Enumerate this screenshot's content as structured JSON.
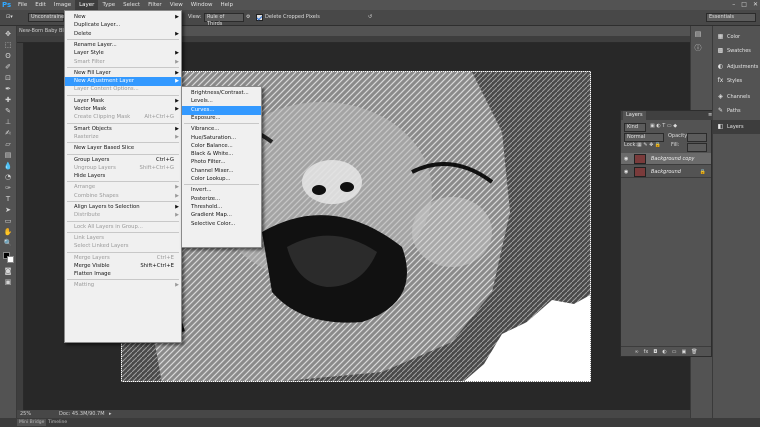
{
  "app": {
    "logo": "Ps",
    "menubar": [
      "File",
      "Edit",
      "Image",
      "Layer",
      "Type",
      "Select",
      "Filter",
      "View",
      "Window",
      "Help"
    ],
    "active_menu": "Layer",
    "window_controls": [
      "–",
      "□",
      "✕"
    ]
  },
  "options_bar": {
    "ratio_select": "Unconstrained",
    "view_label": "View:",
    "view_select": "Rule of Thirds",
    "delete_cropped_label": "Delete Cropped Pixels",
    "workspace_select": "Essentials"
  },
  "document": {
    "tab_title": "New-Born Baby Bla...",
    "zoom": "25%",
    "doc_size": "Doc: 45.3M/90.7M"
  },
  "bottom_tabs": [
    "Mini Bridge",
    "Timeline"
  ],
  "layer_menu": [
    {
      "label": "New",
      "arrow": true
    },
    {
      "label": "Duplicate Layer..."
    },
    {
      "label": "Delete",
      "arrow": true
    },
    {
      "sep": true
    },
    {
      "label": "Rename Layer..."
    },
    {
      "label": "Layer Style",
      "arrow": true
    },
    {
      "label": "Smart Filter",
      "arrow": true,
      "disabled": true
    },
    {
      "sep": true
    },
    {
      "label": "New Fill Layer",
      "arrow": true
    },
    {
      "label": "New Adjustment Layer",
      "arrow": true,
      "highlight": true
    },
    {
      "label": "Layer Content Options...",
      "disabled": true
    },
    {
      "sep": true
    },
    {
      "label": "Layer Mask",
      "arrow": true
    },
    {
      "label": "Vector Mask",
      "arrow": true
    },
    {
      "label": "Create Clipping Mask",
      "shortcut": "Alt+Ctrl+G",
      "disabled": true
    },
    {
      "sep": true
    },
    {
      "label": "Smart Objects",
      "arrow": true
    },
    {
      "label": "Rasterize",
      "arrow": true,
      "disabled": true
    },
    {
      "sep": true
    },
    {
      "label": "New Layer Based Slice"
    },
    {
      "sep": true
    },
    {
      "label": "Group Layers",
      "shortcut": "Ctrl+G"
    },
    {
      "label": "Ungroup Layers",
      "shortcut": "Shift+Ctrl+G",
      "disabled": true
    },
    {
      "label": "Hide Layers"
    },
    {
      "sep": true
    },
    {
      "label": "Arrange",
      "arrow": true,
      "disabled": true
    },
    {
      "label": "Combine Shapes",
      "arrow": true,
      "disabled": true
    },
    {
      "sep": true
    },
    {
      "label": "Align Layers to Selection",
      "arrow": true
    },
    {
      "label": "Distribute",
      "arrow": true,
      "disabled": true
    },
    {
      "sep": true
    },
    {
      "label": "Lock All Layers in Group...",
      "disabled": true
    },
    {
      "sep": true
    },
    {
      "label": "Link Layers",
      "disabled": true
    },
    {
      "label": "Select Linked Layers",
      "disabled": true
    },
    {
      "sep": true
    },
    {
      "label": "Merge Layers",
      "shortcut": "Ctrl+E",
      "disabled": true
    },
    {
      "label": "Merge Visible",
      "shortcut": "Shift+Ctrl+E"
    },
    {
      "label": "Flatten Image"
    },
    {
      "sep": true
    },
    {
      "label": "Matting",
      "arrow": true,
      "disabled": true
    }
  ],
  "adjustment_submenu": [
    {
      "label": "Brightness/Contrast..."
    },
    {
      "label": "Levels..."
    },
    {
      "label": "Curves...",
      "highlight": true
    },
    {
      "label": "Exposure..."
    },
    {
      "sep": true
    },
    {
      "label": "Vibrance..."
    },
    {
      "label": "Hue/Saturation..."
    },
    {
      "label": "Color Balance..."
    },
    {
      "label": "Black & White..."
    },
    {
      "label": "Photo Filter..."
    },
    {
      "label": "Channel Mixer..."
    },
    {
      "label": "Color Lookup..."
    },
    {
      "sep": true
    },
    {
      "label": "Invert..."
    },
    {
      "label": "Posterize..."
    },
    {
      "label": "Threshold..."
    },
    {
      "label": "Gradient Map..."
    },
    {
      "label": "Selective Color..."
    }
  ],
  "dock_panels": [
    {
      "label": "Color",
      "icon": "▦"
    },
    {
      "label": "Swatches",
      "icon": "▩"
    },
    {
      "label": "Adjustments",
      "icon": "◐"
    },
    {
      "label": "Styles",
      "icon": "fx"
    },
    {
      "label": "Channels",
      "icon": "◈"
    },
    {
      "label": "Paths",
      "icon": "✎"
    },
    {
      "label": "Layers",
      "icon": "◧",
      "selected": true
    }
  ],
  "layers_panel": {
    "title": "Layers",
    "filter_kind": "Kind",
    "blend_mode": "Normal",
    "opacity_label": "Opacity:",
    "lock_label": "Lock:",
    "fill_label": "Fill:",
    "layers": [
      {
        "name": "Background copy",
        "selected": true
      },
      {
        "name": "Background",
        "locked": true
      }
    ],
    "footer_icons": [
      "∞",
      "fx",
      "◘",
      "◐",
      "▭",
      "▣",
      "🗑"
    ]
  }
}
